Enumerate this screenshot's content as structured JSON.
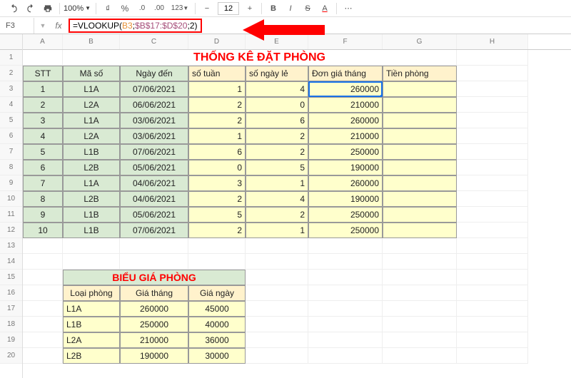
{
  "toolbar": {
    "zoom": "100%",
    "font_size": "12",
    "number_format": "123"
  },
  "formula_bar": {
    "cell_ref": "F3",
    "formula_prefix": "=VLOOKUP(",
    "formula_ref1": "B3",
    "formula_sep1": ";",
    "formula_ref2": "$B$17:$D$20",
    "formula_sep2": ";",
    "formula_arg3": "2",
    "formula_suffix": ")"
  },
  "columns": [
    "A",
    "B",
    "C",
    "D",
    "E",
    "F",
    "G",
    "H"
  ],
  "row_numbers": [
    "1",
    "2",
    "3",
    "4",
    "5",
    "6",
    "7",
    "8",
    "9",
    "10",
    "11",
    "12",
    "13",
    "14",
    "15",
    "16",
    "17",
    "18",
    "19",
    "20"
  ],
  "table1": {
    "title": "THỐNG KÊ ĐẶT PHÒNG",
    "headers": {
      "stt": "STT",
      "ma_so": "Mã số",
      "ngay_den": "Ngày đến",
      "so_tuan": "số tuần",
      "so_ngay_le": "số ngày lẻ",
      "don_gia": "Đơn giá tháng",
      "tien_phong": "Tiền phòng"
    },
    "rows": [
      {
        "stt": "1",
        "ma_so": "L1A",
        "ngay_den": "07/06/2021",
        "so_tuan": "1",
        "so_ngay_le": "4",
        "don_gia": "260000",
        "tien_phong": ""
      },
      {
        "stt": "2",
        "ma_so": "L2A",
        "ngay_den": "06/06/2021",
        "so_tuan": "2",
        "so_ngay_le": "0",
        "don_gia": "210000",
        "tien_phong": ""
      },
      {
        "stt": "3",
        "ma_so": "L1A",
        "ngay_den": "03/06/2021",
        "so_tuan": "2",
        "so_ngay_le": "6",
        "don_gia": "260000",
        "tien_phong": ""
      },
      {
        "stt": "4",
        "ma_so": "L2A",
        "ngay_den": "03/06/2021",
        "so_tuan": "1",
        "so_ngay_le": "2",
        "don_gia": "210000",
        "tien_phong": ""
      },
      {
        "stt": "5",
        "ma_so": "L1B",
        "ngay_den": "07/06/2021",
        "so_tuan": "6",
        "so_ngay_le": "2",
        "don_gia": "250000",
        "tien_phong": ""
      },
      {
        "stt": "6",
        "ma_so": "L2B",
        "ngay_den": "05/06/2021",
        "so_tuan": "0",
        "so_ngay_le": "5",
        "don_gia": "190000",
        "tien_phong": ""
      },
      {
        "stt": "7",
        "ma_so": "L1A",
        "ngay_den": "04/06/2021",
        "so_tuan": "3",
        "so_ngay_le": "1",
        "don_gia": "260000",
        "tien_phong": ""
      },
      {
        "stt": "8",
        "ma_so": "L2B",
        "ngay_den": "04/06/2021",
        "so_tuan": "2",
        "so_ngay_le": "4",
        "don_gia": "190000",
        "tien_phong": ""
      },
      {
        "stt": "9",
        "ma_so": "L1B",
        "ngay_den": "05/06/2021",
        "so_tuan": "5",
        "so_ngay_le": "2",
        "don_gia": "250000",
        "tien_phong": ""
      },
      {
        "stt": "10",
        "ma_so": "L1B",
        "ngay_den": "07/06/2021",
        "so_tuan": "2",
        "so_ngay_le": "1",
        "don_gia": "250000",
        "tien_phong": ""
      }
    ]
  },
  "table2": {
    "title": "BIỂU GIÁ PHÒNG",
    "headers": {
      "loai": "Loại phòng",
      "gia_thang": "Giá tháng",
      "gia_ngay": "Giá ngày"
    },
    "rows": [
      {
        "loai": "L1A",
        "gia_thang": "260000",
        "gia_ngay": "45000"
      },
      {
        "loai": "L1B",
        "gia_thang": "250000",
        "gia_ngay": "40000"
      },
      {
        "loai": "L2A",
        "gia_thang": "210000",
        "gia_ngay": "36000"
      },
      {
        "loai": "L2B",
        "gia_thang": "190000",
        "gia_ngay": "30000"
      }
    ]
  }
}
